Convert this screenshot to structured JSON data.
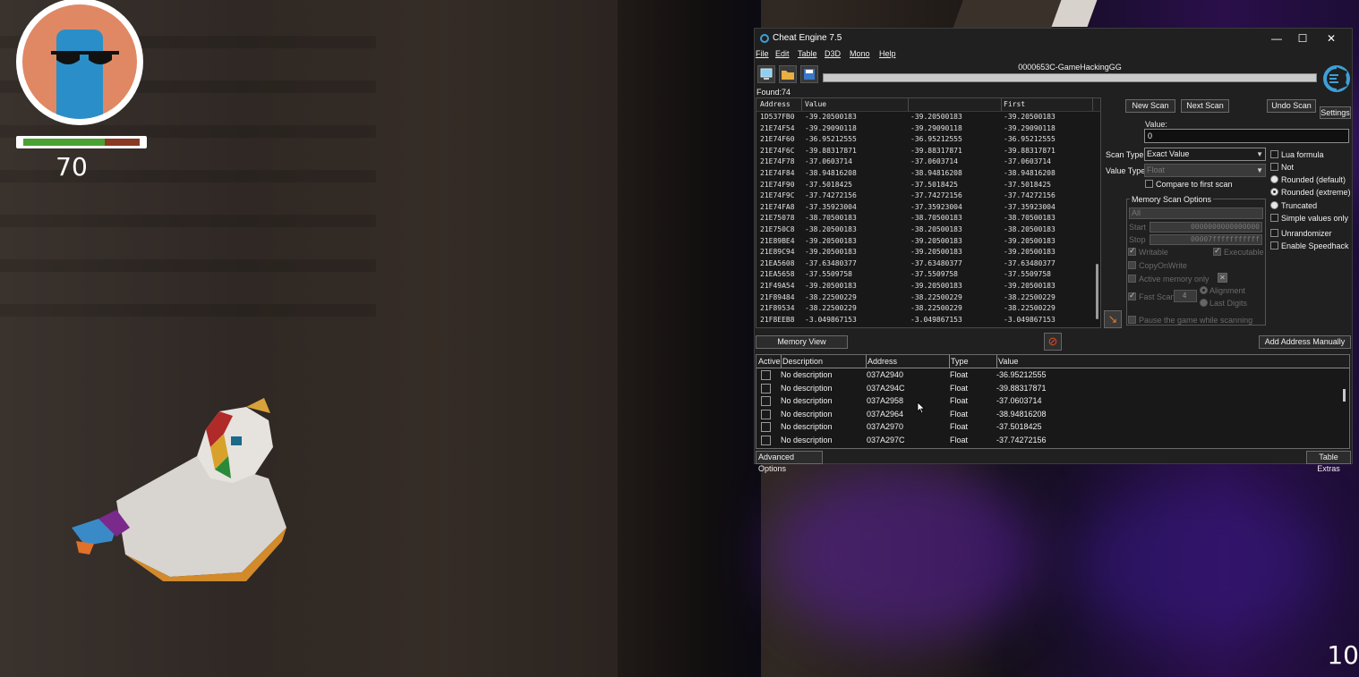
{
  "game": {
    "health_value": "70",
    "health_fraction": 0.7,
    "corner_number": "10"
  },
  "window": {
    "title": "Cheat Engine 7.5",
    "minimize": "—",
    "maximize": "☐",
    "close": "✕"
  },
  "menu": [
    "File",
    "Edit",
    "Table",
    "D3D",
    "Mono",
    "Help"
  ],
  "process": {
    "name": "0000653C-GameHackingGG"
  },
  "found": "Found:74",
  "results": {
    "headers": {
      "address": "Address",
      "value": "Value",
      "previous": "",
      "first": "First"
    },
    "rows": [
      [
        "1D537FB0",
        "-39.20500183",
        "-39.20500183",
        "-39.20500183"
      ],
      [
        "21E74F54",
        "-39.29090118",
        "-39.29090118",
        "-39.29090118"
      ],
      [
        "21E74F60",
        "-36.95212555",
        "-36.95212555",
        "-36.95212555"
      ],
      [
        "21E74F6C",
        "-39.88317871",
        "-39.88317871",
        "-39.88317871"
      ],
      [
        "21E74F78",
        "-37.0603714",
        "-37.0603714",
        "-37.0603714"
      ],
      [
        "21E74F84",
        "-38.94816208",
        "-38.94816208",
        "-38.94816208"
      ],
      [
        "21E74F90",
        "-37.5018425",
        "-37.5018425",
        "-37.5018425"
      ],
      [
        "21E74F9C",
        "-37.74272156",
        "-37.74272156",
        "-37.74272156"
      ],
      [
        "21E74FA8",
        "-37.35923004",
        "-37.35923004",
        "-37.35923004"
      ],
      [
        "21E75078",
        "-38.70500183",
        "-38.70500183",
        "-38.70500183"
      ],
      [
        "21E750C8",
        "-38.20500183",
        "-38.20500183",
        "-38.20500183"
      ],
      [
        "21E89BE4",
        "-39.20500183",
        "-39.20500183",
        "-39.20500183"
      ],
      [
        "21E89C94",
        "-39.20500183",
        "-39.20500183",
        "-39.20500183"
      ],
      [
        "21EA5608",
        "-37.63480377",
        "-37.63480377",
        "-37.63480377"
      ],
      [
        "21EA5658",
        "-37.5509758",
        "-37.5509758",
        "-37.5509758"
      ],
      [
        "21F49A54",
        "-39.20500183",
        "-39.20500183",
        "-39.20500183"
      ],
      [
        "21F89484",
        "-38.22500229",
        "-38.22500229",
        "-38.22500229"
      ],
      [
        "21F89534",
        "-38.22500229",
        "-38.22500229",
        "-38.22500229"
      ],
      [
        "21F8EEB8",
        "-3.049867153",
        "-3.049867153",
        "-3.049867153"
      ]
    ]
  },
  "scan": {
    "new_scan": "New Scan",
    "next_scan": "Next Scan",
    "undo_scan": "Undo Scan",
    "settings": "Settings",
    "value_label": "Value:",
    "value": "0",
    "scan_type_label": "Scan Type",
    "scan_type": "Exact Value",
    "value_type_label": "Value Type",
    "value_type": "Float",
    "compare_first": "Compare to first scan",
    "lua_formula": "Lua formula",
    "not": "Not",
    "rounded_default": "Rounded (default)",
    "rounded_extreme": "Rounded (extreme)",
    "truncated": "Truncated",
    "simple_values": "Simple values only",
    "unrandomizer": "Unrandomizer",
    "speedhack": "Enable Speedhack"
  },
  "memscan": {
    "title": "Memory Scan Options",
    "region": "All",
    "start_label": "Start",
    "start": "0000000000000000",
    "stop_label": "Stop",
    "stop": "00007fffffffffff",
    "writable": "Writable",
    "executable": "Executable",
    "copy_on_write": "CopyOnWrite",
    "active_memory": "Active memory only",
    "fast_scan": "Fast Scan",
    "fast_scan_value": "4",
    "alignment": "Alignment",
    "last_digits": "Last Digits",
    "pause_game": "Pause the game while scanning"
  },
  "buttons": {
    "memory_view": "Memory View",
    "add_address": "Add Address Manually",
    "advanced": "Advanced Options",
    "table_extras": "Table Extras"
  },
  "address_table": {
    "headers": {
      "active": "Active",
      "description": "Description",
      "address": "Address",
      "type": "Type",
      "value": "Value"
    },
    "rows": [
      [
        "No description",
        "037A2940",
        "Float",
        "-36.95212555"
      ],
      [
        "No description",
        "037A294C",
        "Float",
        "-39.88317871"
      ],
      [
        "No description",
        "037A2958",
        "Float",
        "-37.0603714"
      ],
      [
        "No description",
        "037A2964",
        "Float",
        "-38.94816208"
      ],
      [
        "No description",
        "037A2970",
        "Float",
        "-37.5018425"
      ],
      [
        "No description",
        "037A297C",
        "Float",
        "-37.74272156"
      ]
    ]
  },
  "colors": {
    "health_fill": "#4aa232",
    "health_empty": "#8a3a22",
    "ce_background": "#202020",
    "accent": "#3da0d8"
  }
}
